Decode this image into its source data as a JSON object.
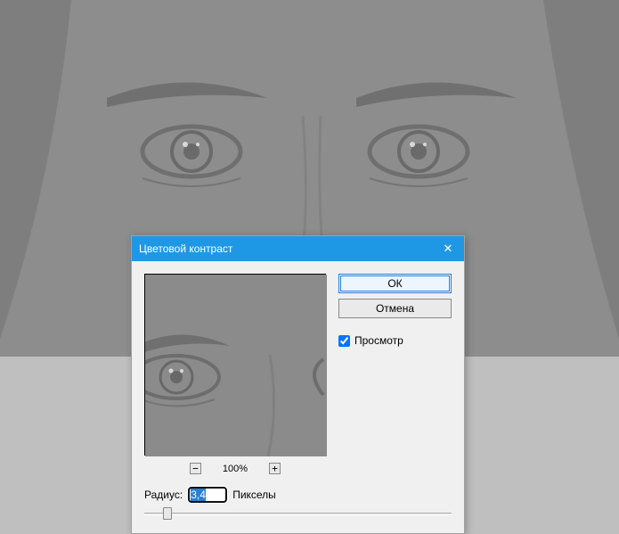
{
  "dialog": {
    "title": "Цветовой контраст",
    "ok_label": "ОК",
    "cancel_label": "Отмена",
    "preview_label": "Просмотр",
    "preview_checked": true,
    "zoom_text": "100%",
    "zoom_out_glyph": "⊟",
    "zoom_in_glyph": "⊞",
    "radius_label": "Радиус:",
    "radius_value": "3,4",
    "radius_unit": "Пикселы",
    "close_glyph": "✕",
    "slider_pos_percent": 6
  }
}
